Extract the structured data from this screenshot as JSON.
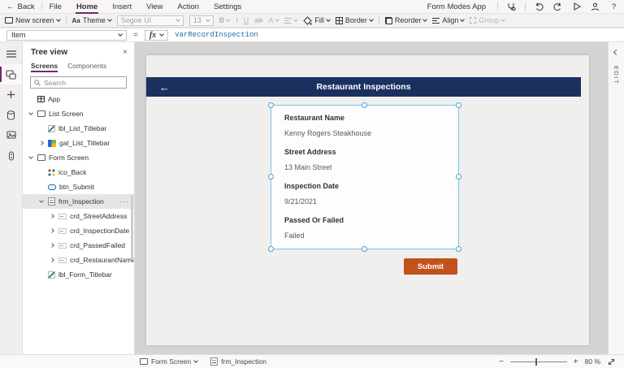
{
  "menubar": {
    "back": "Back",
    "items": [
      "File",
      "Home",
      "Insert",
      "View",
      "Action",
      "Settings"
    ],
    "active_item": "Home",
    "app_name": "Form Modes App",
    "right_icons": [
      "app-checker-icon",
      "undo-icon",
      "redo-icon",
      "play-icon",
      "share-person-icon",
      "help-icon"
    ],
    "help": "?"
  },
  "toolbar": {
    "new_screen": "New screen",
    "theme": "Theme",
    "font_name": "Segoe UI",
    "font_size": "13",
    "bold": "B",
    "italic": "I",
    "underline": "U",
    "strikethrough": "ab",
    "font_color": "A",
    "fill": "Fill",
    "border": "Border",
    "reorder": "Reorder",
    "align": "Align",
    "group": "Group"
  },
  "formula_bar": {
    "property": "Item",
    "equals": "=",
    "fx": "fx",
    "formula": "varRecordInspection"
  },
  "left_rail": {
    "icons": [
      "menu-icon",
      "tree-view-icon",
      "insert-icon",
      "data-icon",
      "media-icon",
      "advanced-tools-icon"
    ],
    "selected": "tree-view-icon"
  },
  "tree": {
    "title": "Tree view",
    "close": "×",
    "tabs": [
      "Screens",
      "Components"
    ],
    "active_tab": "Screens",
    "search_placeholder": "Search",
    "items": [
      {
        "label": "App",
        "icon": "app-icon",
        "depth": 0,
        "chevron": null
      },
      {
        "label": "List Screen",
        "icon": "screen-icon",
        "depth": 0,
        "chevron": "down"
      },
      {
        "label": "lbl_List_Titlebar",
        "icon": "label-icon",
        "depth": 1,
        "chevron": null
      },
      {
        "label": "gal_List_Titlebar",
        "icon": "gallery-icon",
        "depth": 1,
        "chevron": "right"
      },
      {
        "label": "Form Screen",
        "icon": "screen-icon",
        "depth": 0,
        "chevron": "down"
      },
      {
        "label": "ico_Back",
        "icon": "icon-control-icon",
        "depth": 1,
        "chevron": null
      },
      {
        "label": "btn_Submit",
        "icon": "button-icon",
        "depth": 1,
        "chevron": null
      },
      {
        "label": "frm_Inspection",
        "icon": "form-icon",
        "depth": 1,
        "chevron": "down",
        "selected": true,
        "more": "···"
      },
      {
        "label": "crd_StreetAddress",
        "icon": "card-icon",
        "depth": 2,
        "chevron": "right"
      },
      {
        "label": "crd_InspectionDate",
        "icon": "card-icon",
        "depth": 2,
        "chevron": "right"
      },
      {
        "label": "crd_PassedFailed",
        "icon": "card-icon",
        "depth": 2,
        "chevron": "right"
      },
      {
        "label": "crd_RestaurantName",
        "icon": "card-icon",
        "depth": 2,
        "chevron": "right"
      },
      {
        "label": "lbl_Form_Titlebar",
        "icon": "label-icon",
        "depth": 1,
        "chevron": null
      }
    ]
  },
  "canvas": {
    "screen_title": "Restaurant Inspections",
    "back_arrow": "←",
    "form_fields": [
      {
        "label": "Restaurant Name",
        "value": "Kenny Rogers Steakhouse"
      },
      {
        "label": "Street Address",
        "value": "13 Main Street"
      },
      {
        "label": "Inspection Date",
        "value": "9/21/2021"
      },
      {
        "label": "Passed Or Failed",
        "value": "Failed"
      }
    ],
    "submit_label": "Submit"
  },
  "right_panel": {
    "label": "EDIT"
  },
  "statusbar": {
    "screen": "Form Screen",
    "control": "frm_Inspection",
    "zoom": "80 %",
    "minus": "−",
    "plus": "+"
  },
  "colors": {
    "accent": "#742774",
    "titlebar": "#1a3160",
    "submit": "#c2511b",
    "selection": "#45a3d9",
    "formula": "#2271a8"
  }
}
